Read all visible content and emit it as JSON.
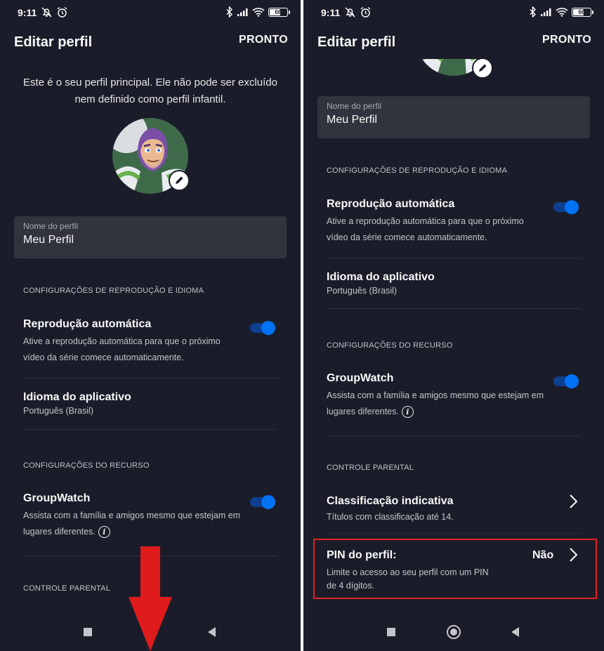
{
  "status_bar": {
    "time": "9:11",
    "battery": "66"
  },
  "battery_level": 0.66,
  "header": {
    "title": "Editar perfil",
    "done_label": "PRONTO"
  },
  "intro_text": "Este é o seu perfil principal. Ele não pode ser excluído nem definido como perfil infantil.",
  "profile_name_field": {
    "label": "Nome do perfil",
    "value": "Meu Perfil"
  },
  "sections": {
    "playback": "CONFIGURAÇÕES DE REPRODUÇÃO E IDIOMA",
    "features": "CONFIGURAÇÕES DO RECURSO",
    "parental": "CONTROLE PARENTAL"
  },
  "autoplay": {
    "title": "Reprodução automática",
    "description": "Ative a reprodução automática para que o próximo vídeo da série comece automaticamente.",
    "enabled": true
  },
  "app_language": {
    "title": "Idioma do aplicativo",
    "value": "Português (Brasil)"
  },
  "groupwatch": {
    "title": "GroupWatch",
    "description": "Assista com a família e amigos mesmo que estejam em lugares diferentes.",
    "enabled": true
  },
  "rating": {
    "title": "Classificação indicativa",
    "description": "Títulos com classificação até 14."
  },
  "profile_pin": {
    "title": "PIN do perfil:",
    "value": "Não",
    "description": "Limite o acesso ao seu perfil com um PIN de 4 dígitos."
  },
  "colors": {
    "background": "#1a1d29",
    "accent": "#0072f5",
    "highlight": "#e32222",
    "annotation_arrow": "#e01b1b"
  },
  "icons": [
    "mute-icon",
    "alarm-icon",
    "bluetooth-icon",
    "signal-icon",
    "wifi-icon",
    "battery-icon",
    "pencil-icon",
    "info-icon",
    "chevron-right-icon"
  ]
}
